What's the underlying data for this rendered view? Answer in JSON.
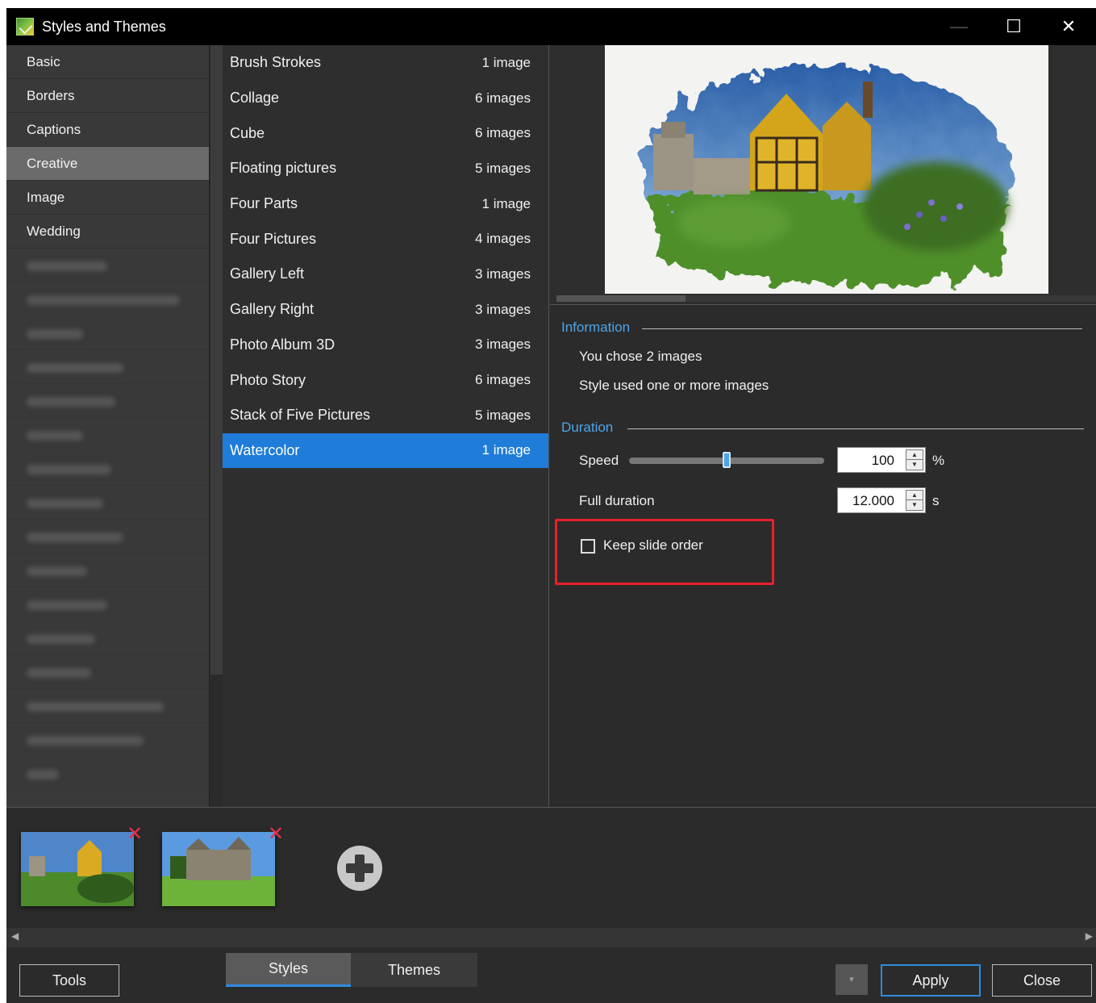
{
  "window": {
    "title": "Styles and Themes",
    "minimize_glyph": "—",
    "maximize_glyph": "☐",
    "close_glyph": "✕"
  },
  "categories": [
    {
      "label": "Basic"
    },
    {
      "label": "Borders"
    },
    {
      "label": "Captions"
    },
    {
      "label": "Creative"
    },
    {
      "label": "Image"
    },
    {
      "label": "Wedding"
    }
  ],
  "selected_category": "Creative",
  "styles": [
    {
      "name": "Brush Strokes",
      "count": "1 image"
    },
    {
      "name": "Collage",
      "count": "6 images"
    },
    {
      "name": "Cube",
      "count": "6 images"
    },
    {
      "name": "Floating pictures",
      "count": "5 images"
    },
    {
      "name": "Four Parts",
      "count": "1 image"
    },
    {
      "name": "Four Pictures",
      "count": "4 images"
    },
    {
      "name": "Gallery Left",
      "count": "3 images"
    },
    {
      "name": "Gallery Right",
      "count": "3 images"
    },
    {
      "name": "Photo Album 3D",
      "count": "3 images"
    },
    {
      "name": "Photo Story",
      "count": "6 images"
    },
    {
      "name": "Stack of Five Pictures",
      "count": "5 images"
    },
    {
      "name": "Watercolor",
      "count": "1 image"
    }
  ],
  "selected_style": "Watercolor",
  "information": {
    "heading": "Information",
    "line1": "You chose 2 images",
    "line2": "Style used one or more images"
  },
  "duration": {
    "heading": "Duration",
    "speed_label": "Speed",
    "speed_value": "100",
    "speed_unit": "%",
    "full_duration_label": "Full duration",
    "full_duration_value": "12.000",
    "full_duration_unit": "s",
    "keep_order_label": "Keep slide order",
    "keep_order_checked": false
  },
  "thumbnails": {
    "remove_glyph": "✕"
  },
  "bottom": {
    "tools_label": "Tools",
    "tab_styles": "Styles",
    "tab_themes": "Themes",
    "apply_label": "Apply",
    "close_label": "Close",
    "dropdown_glyph": "▼"
  },
  "colors": {
    "accent": "#1f7cd8",
    "heading_blue": "#4ea5e6",
    "highlight_red": "#e8202a"
  }
}
